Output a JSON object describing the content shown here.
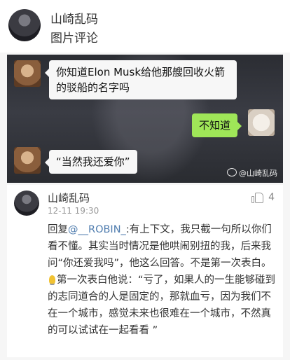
{
  "header": {
    "name": "山崎乱码",
    "subtitle": "图片评论"
  },
  "chat": {
    "message1": "你知道Elon Musk给他那艘回收火箭的驳船的名字吗",
    "message2": "不知道",
    "message3": "“当然我还爱你”",
    "watermark": "@山崎乱码"
  },
  "comment": {
    "name": "山崎乱码",
    "time": "12-11 19:30",
    "likes": "4",
    "reply_prefix": "回复",
    "mention": "@__ROBIN_",
    "text_part1": ":有上下文，我只截一句所以你们看不懂。其实当时情况是他哄闹别扭的我，后来我问“你还爱我吗”，他这么回答。不是第一次表白。",
    "text_part2": "第一次表白他说：“亏了，如果人的一生能够碰到的志同道合的人是固定的，那就血亏，因为我们不在一个城市，感觉未来也很难在一个城市，不然真的可以试试在一起看看 ”"
  }
}
